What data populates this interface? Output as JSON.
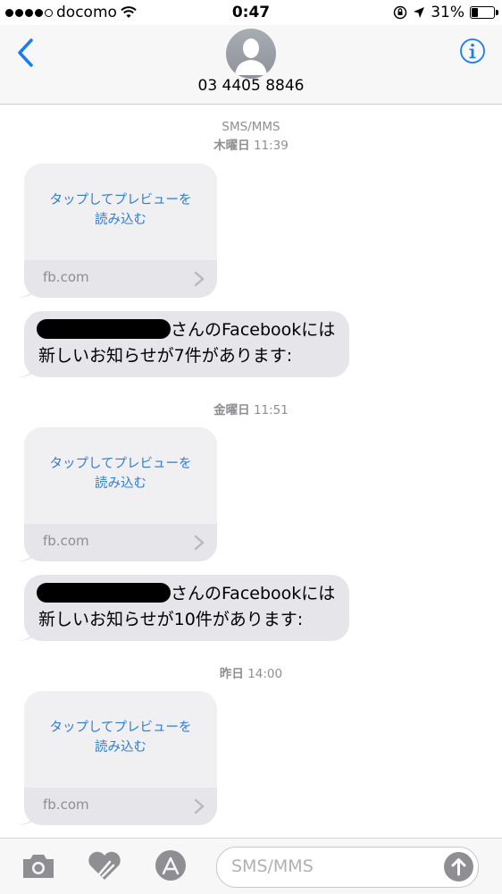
{
  "status": {
    "carrier": "docomo",
    "time": "0:47",
    "battery": "31%"
  },
  "header": {
    "contact": "03 4405 8846"
  },
  "conversation": {
    "stamp1_service": "SMS/MMS",
    "stamp1_day": "木曜日",
    "stamp1_time": "11:39",
    "stamp2_day": "金曜日",
    "stamp2_time": "11:51",
    "stamp3_day": "昨日",
    "stamp3_time": "14:00"
  },
  "previews": [
    {
      "line1": "タップしてプレビューを",
      "line2": "読み込む",
      "domain": "fb.com"
    },
    {
      "line1": "タップしてプレビューを",
      "line2": "読み込む",
      "domain": "fb.com"
    },
    {
      "line1": "タップしてプレビューを",
      "line2": "読み込む",
      "domain": "fb.com"
    }
  ],
  "messages": [
    {
      "line1": "さんのFacebookには",
      "line2": "新しいお知らせが7件があります:"
    },
    {
      "line1": "さんのFacebookには",
      "line2": "新しいお知らせが10件があります:"
    }
  ],
  "input": {
    "placeholder": "SMS/MMS"
  },
  "icons": [
    "camera-icon",
    "digital-touch-icon",
    "app-store-icon",
    "send-arrow-icon",
    "back-chevron-icon",
    "info-icon"
  ]
}
